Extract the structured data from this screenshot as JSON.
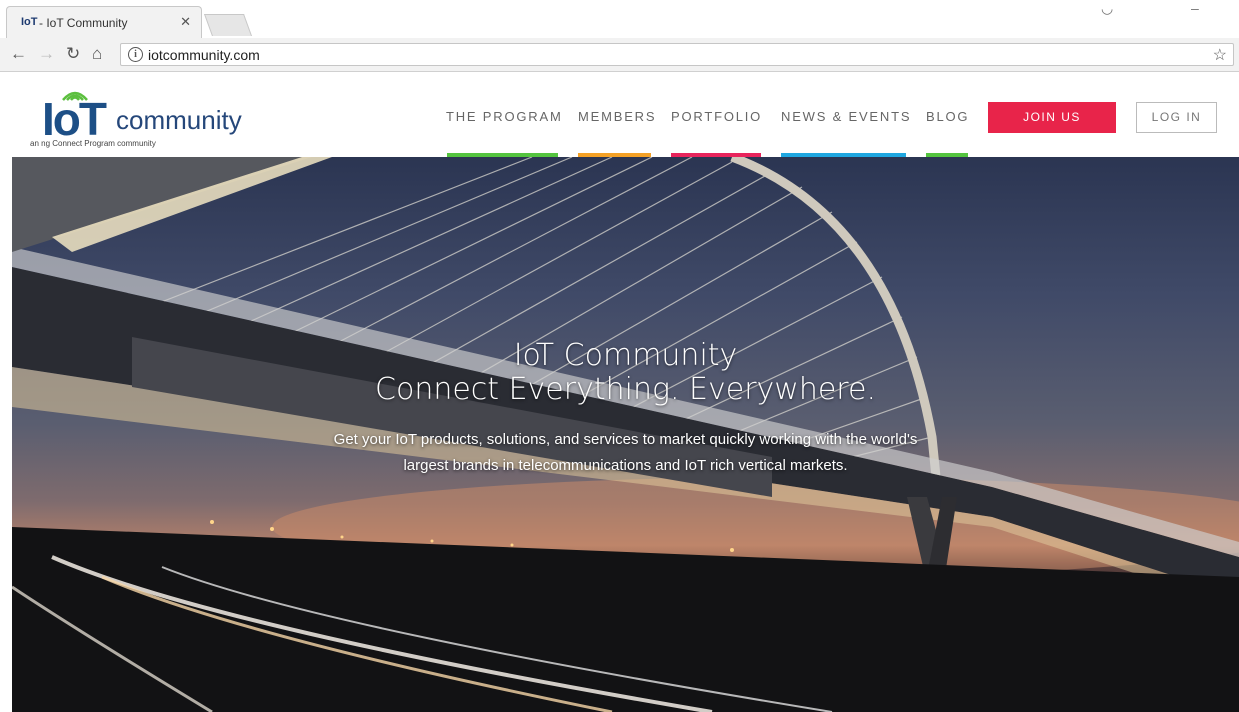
{
  "browser": {
    "tab": {
      "favicon_text": "IoT",
      "title": "- IoT Community"
    },
    "url": "iotcommunity.com"
  },
  "header": {
    "logo": {
      "mark": "IoT",
      "word": "community",
      "tagline": "an ng Connect Program community"
    },
    "nav": [
      {
        "label": "THE PROGRAM",
        "accent": "#54c43f"
      },
      {
        "label": "MEMBERS",
        "accent": "#f4a126"
      },
      {
        "label": "PORTFOLIO",
        "accent": "#e8245c"
      },
      {
        "label": "NEWS & EVENTS",
        "accent": "#1fa7e1"
      },
      {
        "label": "BLOG",
        "accent": "#54c43f"
      }
    ],
    "join_label": "JOIN US",
    "login_label": "LOG IN"
  },
  "hero": {
    "title_line1": "IoT Community",
    "title_line2": "Connect Everything. Everywhere.",
    "sub_line1": "Get your IoT products, solutions, and services to market quickly working with the world's",
    "sub_line2": "largest brands in telecommunications and IoT rich vertical markets."
  },
  "colors": {
    "brand_blue": "#1d4f86",
    "join_red": "#e8244a"
  }
}
